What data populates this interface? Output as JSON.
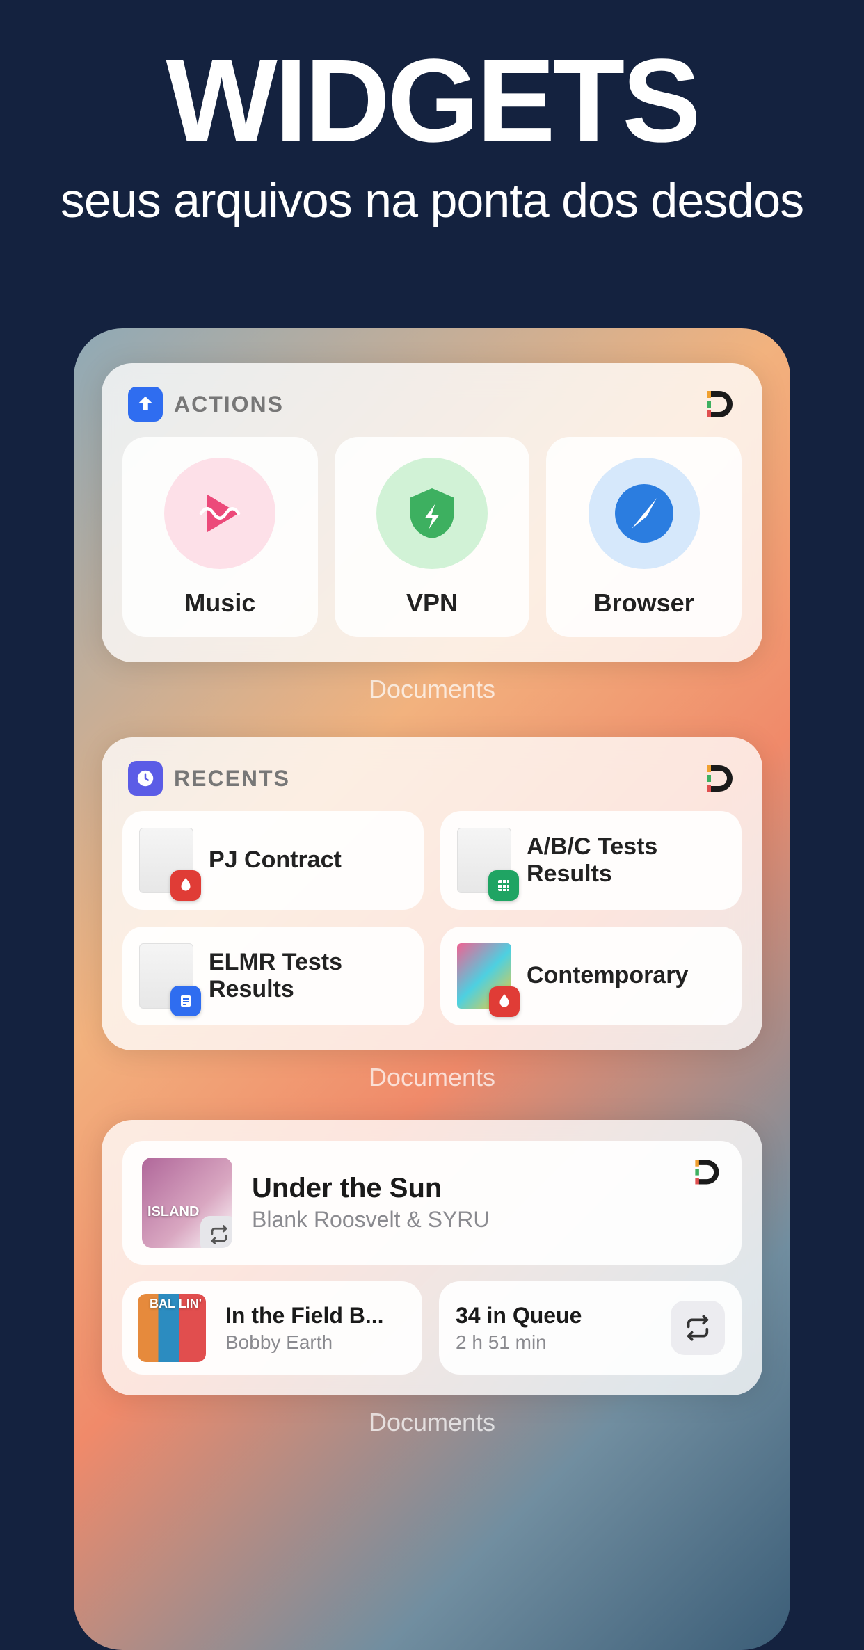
{
  "hero": {
    "title": "WIDGETS",
    "subtitle": "seus arquivos na ponta dos desdos"
  },
  "actions_widget": {
    "header": "ACTIONS",
    "caption": "Documents",
    "items": [
      {
        "label": "Music"
      },
      {
        "label": "VPN"
      },
      {
        "label": "Browser"
      }
    ]
  },
  "recents_widget": {
    "header": "RECENTS",
    "caption": "Documents",
    "items": [
      {
        "label": "PJ Contract",
        "badge": "pdf"
      },
      {
        "label": "A/B/C Tests Results",
        "badge": "sheet"
      },
      {
        "label": "ELMR Tests Results",
        "badge": "doc"
      },
      {
        "label": "Contemporary",
        "badge": "pdf"
      }
    ]
  },
  "music_widget": {
    "caption": "Documents",
    "now_playing": {
      "title": "Under the Sun",
      "artist": "Blank Roosvelt & SYRU",
      "album_text": "ISLAND"
    },
    "next": {
      "title": "In the Field B...",
      "artist": "Bobby Earth",
      "album_text": "BAL\nLIN'"
    },
    "queue": {
      "title": "34 in Queue",
      "sub": "2 h 51 min"
    }
  }
}
